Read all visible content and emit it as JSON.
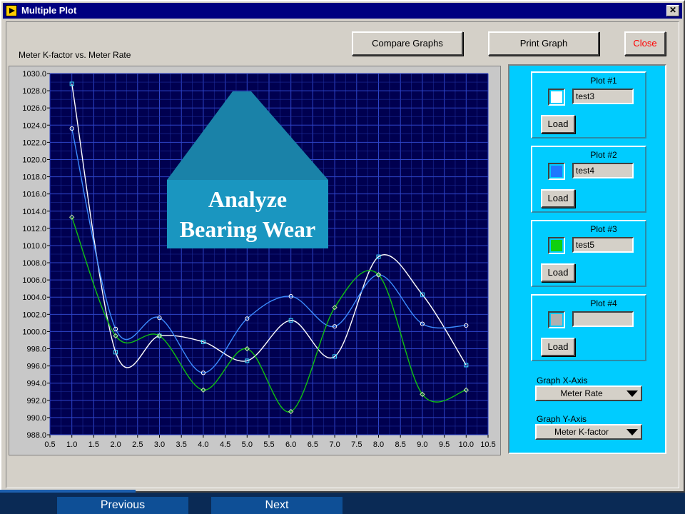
{
  "window": {
    "title": "Multiple Plot",
    "close_glyph": "✕"
  },
  "toolbar": {
    "compare_label": "Compare Graphs",
    "print_label": "Print Graph",
    "close_label": "Close"
  },
  "callout": {
    "text": "Analyze\nBearing Wear",
    "color": "#1a96c0"
  },
  "panel": {
    "plots": [
      {
        "label": "Plot #1",
        "name": "test3",
        "color": "#ffffff",
        "load_label": "Load"
      },
      {
        "label": "Plot #2",
        "name": "test4",
        "color": "#1e78ff",
        "load_label": "Load"
      },
      {
        "label": "Plot #3",
        "name": "test5",
        "color": "#10d010",
        "load_label": "Load"
      },
      {
        "label": "Plot #4",
        "name": "",
        "color": "#b0b0b0",
        "load_label": "Load"
      }
    ],
    "x_axis_label": "Graph X-Axis",
    "x_axis_value": "Meter Rate",
    "y_axis_label": "Graph Y-Axis",
    "y_axis_value": "Meter K-factor"
  },
  "nav": {
    "previous_label": "Previous",
    "next_label": "Next"
  },
  "chart_data": {
    "type": "line",
    "title": "Meter K-factor vs. Meter Rate",
    "xlim": [
      0.5,
      10.5
    ],
    "ylim": [
      988.0,
      1030.0
    ],
    "x_ticks": [
      "0.5",
      "1.0",
      "1.5",
      "2.0",
      "2.5",
      "3.0",
      "3.5",
      "4.0",
      "4.5",
      "5.0",
      "5.5",
      "6.0",
      "6.5",
      "7.0",
      "7.5",
      "8.0",
      "8.5",
      "9.0",
      "9.5",
      "10.0",
      "10.5"
    ],
    "y_ticks": [
      "988.0",
      "990.0",
      "992.0",
      "994.0",
      "996.0",
      "998.0",
      "1000.0",
      "1002.0",
      "1004.0",
      "1006.0",
      "1008.0",
      "1010.0",
      "1012.0",
      "1014.0",
      "1016.0",
      "1018.0",
      "1020.0",
      "1022.0",
      "1024.0",
      "1026.0",
      "1028.0",
      "1030.0"
    ],
    "grid": true,
    "series": [
      {
        "color": "#ffffff",
        "marker": "square",
        "x": [
          1.0,
          2.0,
          3.0,
          4.0,
          5.0,
          6.0,
          7.0,
          8.0,
          9.0,
          10.0
        ],
        "y": [
          1028.8,
          997.6,
          999.5,
          998.8,
          996.6,
          1001.3,
          997.1,
          1008.7,
          1004.3,
          996.1
        ]
      },
      {
        "color": "#3c8cff",
        "marker": "circle",
        "x": [
          1.0,
          2.0,
          3.0,
          4.0,
          5.0,
          6.0,
          7.0,
          8.0,
          9.0,
          10.0
        ],
        "y": [
          1023.6,
          1000.3,
          1001.6,
          995.2,
          1001.5,
          1004.1,
          1000.6,
          1006.6,
          1000.9,
          1000.7
        ]
      },
      {
        "color": "#10c010",
        "marker": "diamond",
        "x": [
          1.0,
          2.0,
          3.0,
          4.0,
          5.0,
          6.0,
          7.0,
          8.0,
          9.0,
          10.0
        ],
        "y": [
          1013.3,
          999.5,
          999.5,
          993.2,
          998.0,
          990.7,
          1002.8,
          1006.6,
          992.7,
          993.2
        ]
      }
    ]
  }
}
